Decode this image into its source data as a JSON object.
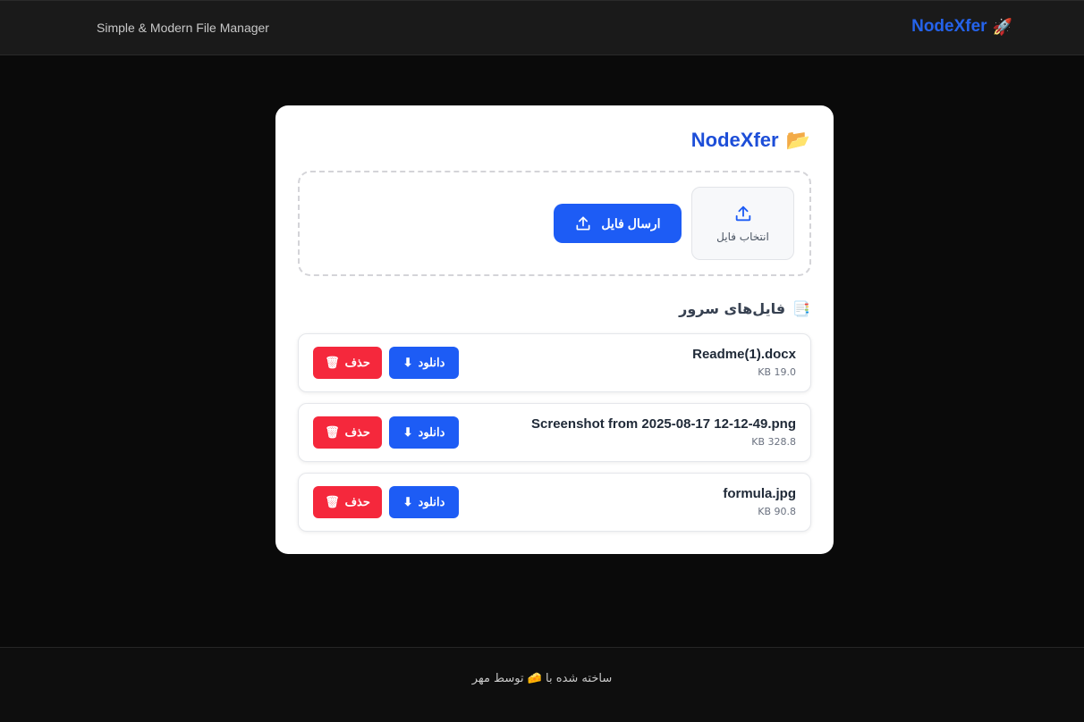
{
  "header": {
    "brand": "NodeXfer",
    "brand_icon": "🚀",
    "tagline": "Simple & Modern File Manager"
  },
  "card": {
    "title": "NodeXfer",
    "title_icon": "📂",
    "pick_label": "انتخاب فایل",
    "send_label": "ارسال فایل",
    "section_title": "فایل‌های سرور",
    "section_icon": "📑"
  },
  "files": [
    {
      "name": "Readme(1).docx",
      "size": "19.0 KB",
      "download": "دانلود",
      "delete": "حذف"
    },
    {
      "name": "Screenshot from 2025-08-17 12-12-49.png",
      "size": "328.8 KB",
      "download": "دانلود",
      "delete": "حذف"
    },
    {
      "name": "formula.jpg",
      "size": "90.8 KB",
      "download": "دانلود",
      "delete": "حذف"
    }
  ],
  "footer": {
    "text": "ساخته شده با 🧀 توسط مهر"
  },
  "colors": {
    "accent": "#1d5cf5",
    "danger": "#f5283c",
    "brand": "#2563eb"
  }
}
